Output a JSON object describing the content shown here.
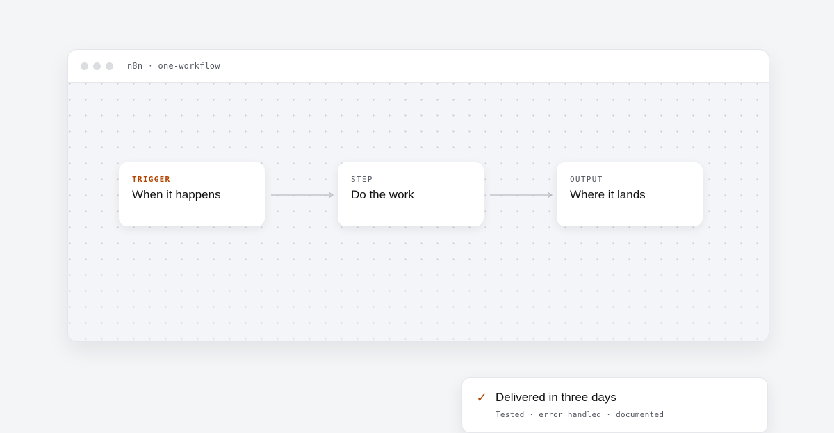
{
  "window": {
    "title": "n8n · one-workflow"
  },
  "nodes": [
    {
      "kicker": "TRIGGER",
      "title": "When it happens"
    },
    {
      "kicker": "STEP",
      "title": "Do the work"
    },
    {
      "kicker": "OUTPUT",
      "title": "Where it lands"
    }
  ],
  "toast": {
    "icon": "check-icon",
    "check_glyph": "✓",
    "title": "Delivered in three days",
    "subtitle": "Tested · error handled · documented"
  },
  "colors": {
    "accent": "#b34400",
    "background": "#f4f5f7",
    "card": "#ffffff",
    "window_dot": "#dcdde0"
  }
}
